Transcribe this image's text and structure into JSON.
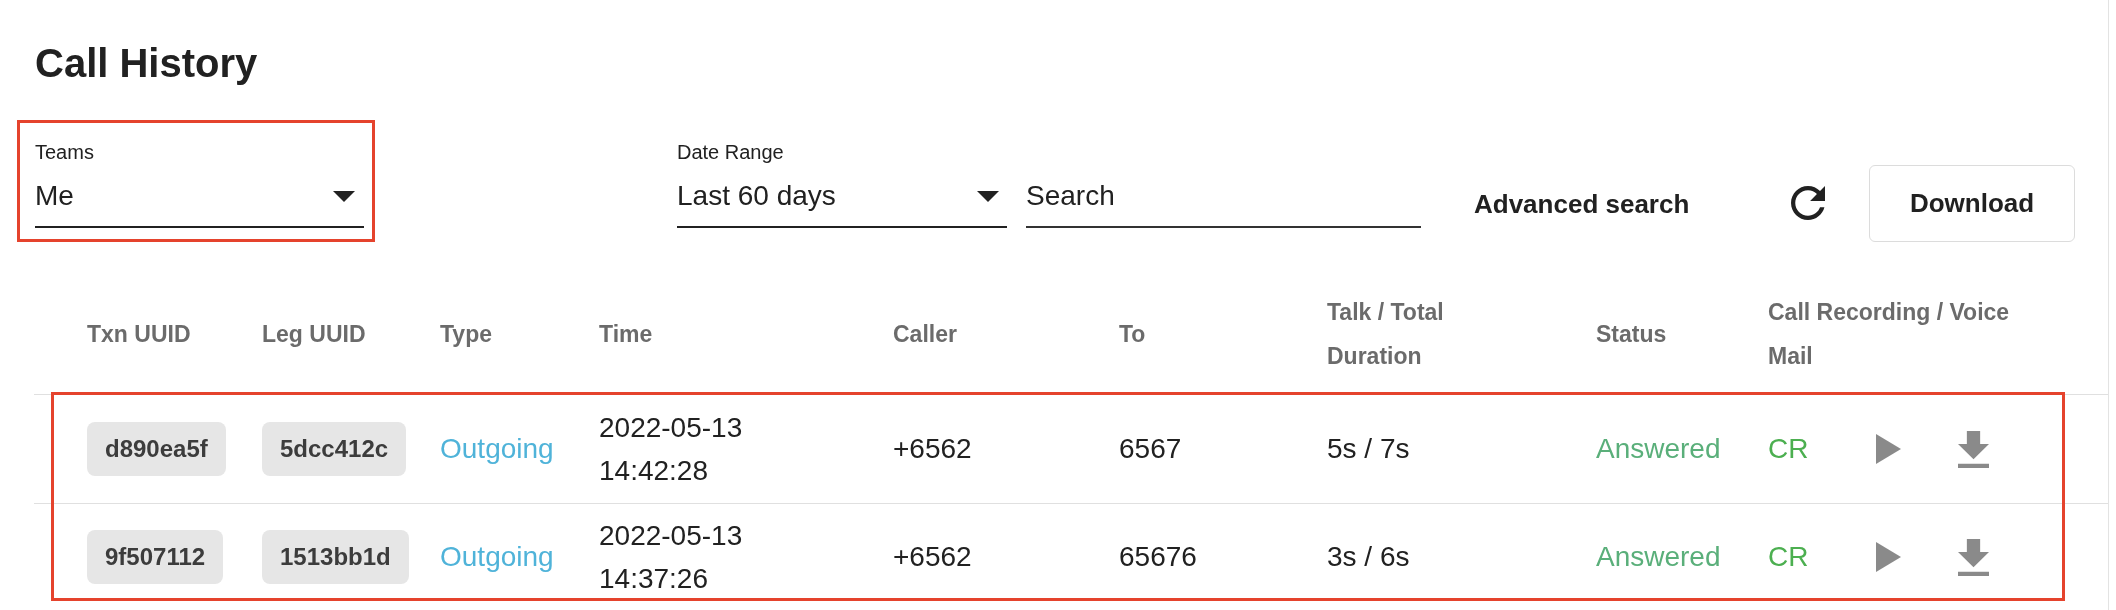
{
  "page": {
    "title": "Call History"
  },
  "filters": {
    "teams": {
      "label": "Teams",
      "value": "Me",
      "highlighted": true
    },
    "date_range": {
      "label": "Date Range",
      "value": "Last 60 days"
    },
    "search": {
      "placeholder": "Search"
    },
    "advanced_search": {
      "label": "Advanced search"
    },
    "download": {
      "label": "Download"
    }
  },
  "table": {
    "columns": [
      "Txn UUID",
      "Leg UUID",
      "Type",
      "Time",
      "Caller",
      "To",
      "Talk / Total Duration",
      "Status",
      "Call Recording / Voice Mail"
    ],
    "rows_highlighted": true,
    "rows": [
      {
        "txn_uuid": "d890ea5f",
        "leg_uuid": "5dcc412c",
        "type": "Outgoing",
        "time": "2022-05-13 14:42:28",
        "caller": "+6562",
        "to": "6567",
        "duration": "5s / 7s",
        "status": "Answered",
        "recording": "CR"
      },
      {
        "txn_uuid": "9f507112",
        "leg_uuid": "1513bb1d",
        "type": "Outgoing",
        "time": "2022-05-13 14:37:26",
        "caller": "+6562",
        "to": "65676",
        "duration": "3s / 6s",
        "status": "Answered",
        "recording": "CR"
      }
    ]
  }
}
